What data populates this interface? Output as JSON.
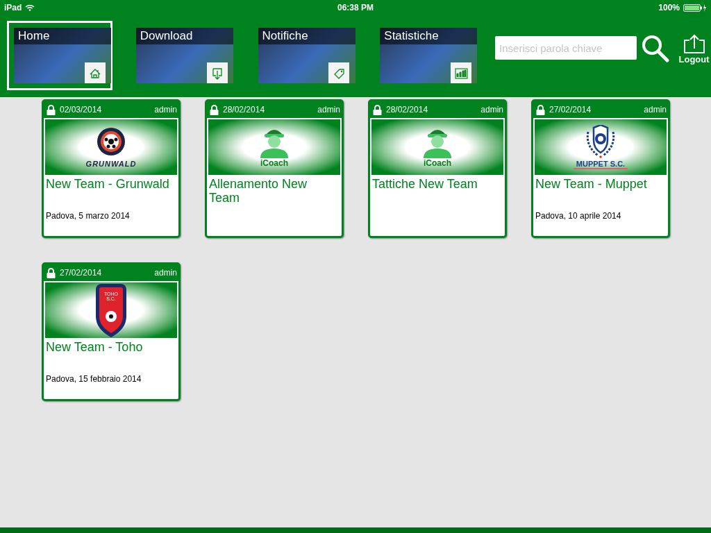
{
  "status_bar": {
    "device": "iPad",
    "time": "06:38 PM",
    "battery": "100%"
  },
  "nav_tabs": [
    {
      "label": "Home",
      "selected": true,
      "kind": "home"
    },
    {
      "label": "Download",
      "selected": false,
      "kind": "download"
    },
    {
      "label": "Notifiche",
      "selected": false,
      "kind": "tag"
    },
    {
      "label": "Statistiche",
      "selected": false,
      "kind": "chart"
    }
  ],
  "search": {
    "placeholder": "Inserisci parola chiave"
  },
  "logout": {
    "label": "Logout"
  },
  "cards": [
    {
      "date": "02/03/2014",
      "author": "admin",
      "locked": true,
      "kind": "ring",
      "logo_text": "GRUNWALD",
      "title": "New Team - Grunwald",
      "subtitle": "Padova, 5 marzo 2014"
    },
    {
      "date": "28/02/2014",
      "author": "admin",
      "locked": true,
      "kind": "coach",
      "logo_text": "iCoach",
      "title": "Allenamento New Team"
    },
    {
      "date": "28/02/2014",
      "author": "admin",
      "locked": true,
      "kind": "coach",
      "logo_text": "iCoach",
      "title": "Tattiche New Team"
    },
    {
      "date": "27/02/2014",
      "author": "admin",
      "locked": true,
      "kind": "laurel",
      "logo_text": "MUPPET S.C.",
      "title": "New Team - Muppet",
      "subtitle": "Padova, 10 aprile 2014"
    },
    {
      "date": "27/02/2014",
      "author": "admin",
      "locked": true,
      "kind": "shield",
      "logo_text": "TOHO S.C.",
      "title": "New Team - Toho",
      "subtitle": "Padova, 15 febbraio 2014"
    }
  ]
}
